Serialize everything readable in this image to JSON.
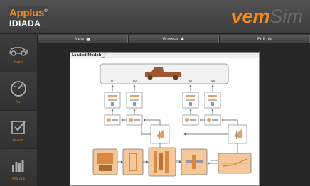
{
  "header": {
    "logo_top": "Applus",
    "logo_reg": "®",
    "logo_bottom": "IDIADA",
    "brand_part1": "vem",
    "brand_part2": "Sim"
  },
  "toolbar": {
    "new_label": "New",
    "browse_label": "Browse",
    "edit_label": "Edit"
  },
  "sidebar": {
    "items": [
      {
        "label": "Model",
        "icon": "car-icon"
      },
      {
        "label": "Test",
        "icon": "gauge-icon"
      },
      {
        "label": "Results",
        "icon": "checkbox-icon"
      },
      {
        "label": "Analysis",
        "icon": "bar-chart-icon"
      }
    ]
  },
  "model": {
    "title": "Loaded Model: _/",
    "wheel_labels": [
      "FL",
      "FR",
      "RL",
      "RR"
    ]
  },
  "colors": {
    "accent": "#f28a1e",
    "component_fill": "#f4c89a",
    "component_border": "#777777"
  }
}
